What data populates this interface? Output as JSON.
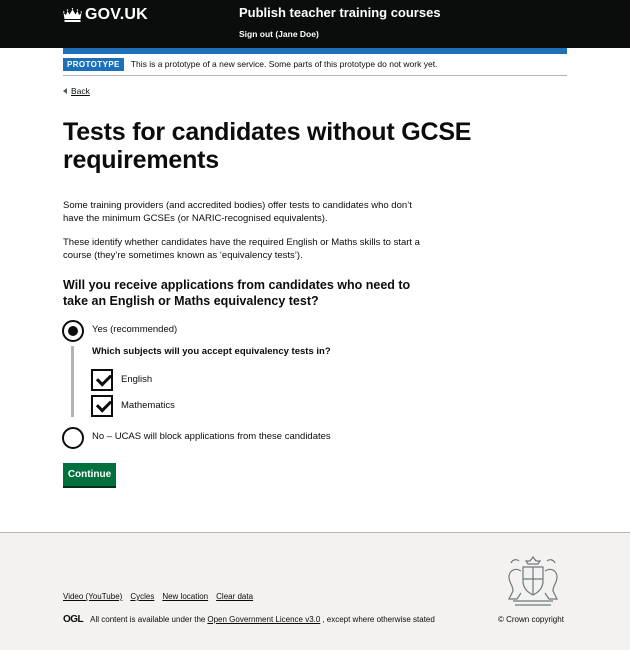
{
  "header": {
    "logo_text": "GOV.UK",
    "service_name": "Publish teacher training courses",
    "signout_label": "Sign out (Jane Doe)"
  },
  "phase_banner": {
    "tag": "PROTOTYPE",
    "text": "This is a prototype of a new service. Some parts of this prototype do not work yet."
  },
  "back_link": "Back",
  "page": {
    "title": "Tests for candidates without GCSE requirements",
    "paragraph_1": "Some training providers (and accredited bodies) offer tests to candidates who don’t have the minimum GCSEs (or NARIC-recognised equivalents).",
    "paragraph_2": "These identify whether candidates have the required English or Maths skills to start a course (they’re sometimes known as ‘equivalency tests’).",
    "question": "Will you receive applications from candidates who need to take an English or Maths equivalency test?",
    "options": {
      "yes": {
        "label": "Yes (recommended)",
        "selected": true
      },
      "no": {
        "label": "No – UCAS will block applications from these candidates",
        "selected": false
      }
    },
    "subquestion": "Which subjects will you accept equivalency tests in?",
    "subjects": {
      "english": {
        "label": "English",
        "checked": true
      },
      "maths": {
        "label": "Mathematics",
        "checked": true
      }
    },
    "continue_label": "Continue"
  },
  "footer": {
    "links": {
      "video": "Video (YouTube)",
      "cycles": "Cycles",
      "new_location": "New location",
      "clear_data": "Clear data"
    },
    "ogl_logo": "OGL",
    "licence_prefix": "All content is available under the",
    "licence_link": "Open Government Licence v3.0",
    "licence_suffix": ", except where otherwise stated",
    "copyright": "© Crown copyright"
  },
  "colors": {
    "header": "#0b0c0c",
    "brand_blue": "#1d70b8",
    "button_green": "#00703c",
    "footer_bg": "#f3f2f1"
  }
}
